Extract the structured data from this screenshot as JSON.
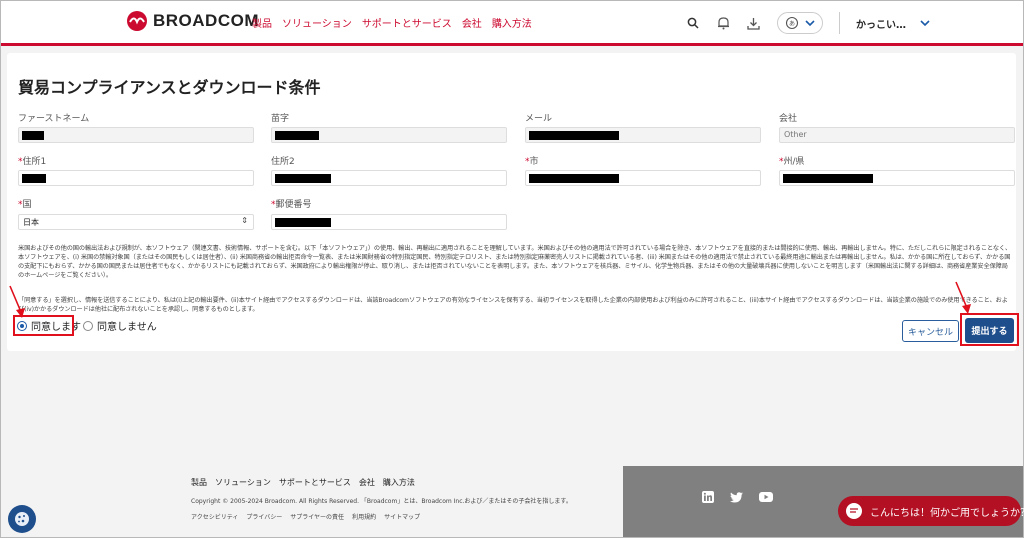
{
  "brand": {
    "name": "BROADCOM",
    "color": "#cc092f"
  },
  "nav": {
    "items": [
      "製品",
      "ソリューション",
      "サポートとサービス",
      "会社",
      "購入方法"
    ]
  },
  "header": {
    "user_name": "かっこい…",
    "icons": [
      "search-icon",
      "bell-icon",
      "download-icon",
      "language-icon",
      "chevron-down-icon"
    ]
  },
  "form": {
    "title": "貿易コンプライアンスとダウンロード条件",
    "fields": {
      "first_name": {
        "label": "ファーストネーム",
        "required": false
      },
      "last_name": {
        "label": "苗字",
        "required": false
      },
      "email": {
        "label": "メール",
        "required": false
      },
      "company": {
        "label": "会社",
        "required": false,
        "placeholder": "Other"
      },
      "address1": {
        "label": "住所1",
        "required": true
      },
      "address2": {
        "label": "住所2",
        "required": false
      },
      "city": {
        "label": "市",
        "required": true
      },
      "state": {
        "label": "州/県",
        "required": true
      },
      "country": {
        "label": "国",
        "required": true,
        "value": "日本"
      },
      "postal": {
        "label": "郵便番号",
        "required": true
      }
    },
    "required_mark": "*",
    "legal_text_1": "米国およびその他の国の輸出法および規制が、本ソフトウェア（関連文書、技術情報、サポートを含む。以下「本ソフトウェア」）の使用、輸出、再輸出に適用されることを理解しています。米国およびその他の適用法で許可されている場合を除き、本ソフトウェアを直接的または間接的に使用、輸出、再輸出しません。特に、ただしこれらに限定されることなく、本ソフトウェアを、(i) 米国の禁輸対象国（またはその国民もしくは居住者）、(ii) 米国商務省の輸出拒否命令一覧表、または米国財務省の特別指定国民、特別指定テロリスト、または特別指定麻薬密売人リストに掲載されている者、(iii) 米国またはその他の適用法で禁止されている最終用途に輸出または再輸出しません。私は、かかる国に所在しておらず、かかる国の支配下にもおらず、かかる国の国民または居住者でもなく、かかるリストにも記載されておらず、米国政府により輸出権限が停止、取り消し、または拒否されていないことを表明します。また、本ソフトウェアを核兵器、ミサイル、化学生物兵器、またはその他の大量破壊兵器に使用しないことを明言します（米国輸出法に関する詳細は、商務省産業安全保障局のホームページをご覧ください）。",
    "legal_text_2": "「同意する」を選択し、情報を送信することにより、私は(i)上記の輸出要件、(ii)本サイト経由でアクセスするダウンロードは、当該Broadcomソフトウェアの有効なライセンスを保有する、当初ライセンスを取得した企業の内部使用および利益のみに許可されること、(iii)本サイト経由でアクセスするダウンロードは、当該企業の施設でのみ使用できること、および(iv)かかるダウンロードは他社に配布されないことを承認し、同意するものとします。",
    "agree_label": "同意します",
    "disagree_label": "同意しません",
    "agree_selected": true,
    "cancel_label": "キャンセル",
    "submit_label": "提出する"
  },
  "footer": {
    "nav": [
      "製品",
      "ソリューション",
      "サポートとサービス",
      "会社",
      "購入方法"
    ],
    "copyright": "Copyright © 2005-2024 Broadcom. All Rights Reserved. 「Broadcom」とは、Broadcom Inc.および／またはその子会社を指します。",
    "links": [
      "アクセシビリティ",
      "プライバシー",
      "サプライヤーの責任",
      "利用規約",
      "サイトマップ"
    ],
    "social_icons": [
      "linkedin-icon",
      "twitter-icon",
      "youtube-icon"
    ],
    "chat_label": "こんにちは！何かご用でしょうか？"
  },
  "colors": {
    "accent": "#cc092f",
    "primary_button": "#1e4e8c",
    "highlight": "#e0101c",
    "chat": "#b31024",
    "footer_dark": "#808080"
  }
}
